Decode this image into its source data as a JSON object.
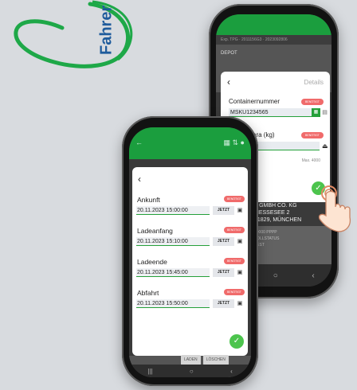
{
  "logo": {
    "text": "Fahrer"
  },
  "back_phone": {
    "status_text": "Exp. TPG · 2011156G3 · 2023092806",
    "depot_label": "DEPOT",
    "details_label": "Details",
    "container_label": "Containernummer",
    "container_value": "MSKU1234565",
    "badge": "BENÖTIGT",
    "tara_label": "Tara (kg)",
    "max_label": "Max. 4000",
    "address": [
      "T GMBH CO. KG",
      "MESSESEE 2",
      "81829, MÜNCHEN"
    ],
    "lower_lines": [
      "20000 PPPP",
      "ZOLLSTATUS",
      "TEST"
    ],
    "nav": [
      "|||",
      "○",
      "‹"
    ]
  },
  "front_phone": {
    "rows": [
      {
        "label": "Ankunft",
        "value": "20.11.2023 15:00:00",
        "badge": "BENÖTIGT",
        "button": "JETZT"
      },
      {
        "label": "Ladeanfang",
        "value": "20.11.2023 15:10:00",
        "badge": "BENÖTIGT",
        "button": "JETZT"
      },
      {
        "label": "Ladeende",
        "value": "20.11.2023 15:45:00",
        "badge": "BENÖTIGT",
        "button": "JETZT"
      },
      {
        "label": "Abfahrt",
        "value": "20.11.2023 15:50:00",
        "badge": "BENÖTIGT",
        "button": "JETZT"
      }
    ],
    "bottom_buttons": [
      "LADEN",
      "LÖSCHEN"
    ],
    "nav": [
      "|||",
      "○",
      "‹"
    ]
  },
  "colors": {
    "brand_green": "#1b9e3e",
    "badge_red": "#f06b6b",
    "check_green": "#4cc44d",
    "logo_blue": "#1e5b9c"
  }
}
